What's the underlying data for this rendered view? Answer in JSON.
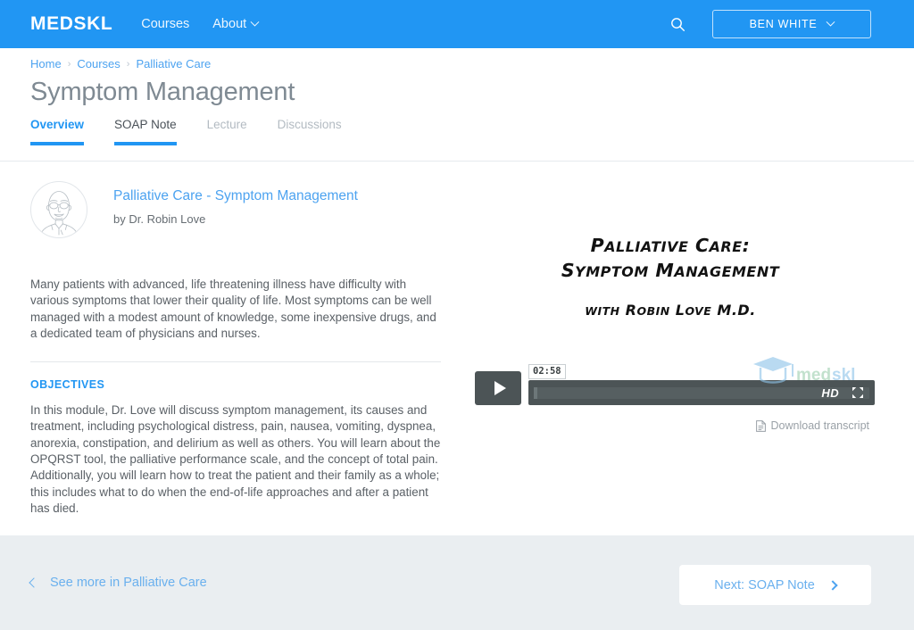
{
  "theme": {
    "brand_blue": "#2196f3",
    "link_blue": "#4da3f0",
    "title_gray": "#7f8a93",
    "body_gray": "#5a6066",
    "footer_bg": "#eaeef1",
    "player_dark": "#4c5456"
  },
  "topnav": {
    "brand": "MEDSKL",
    "links": [
      {
        "label": "Courses",
        "has_caret": false
      },
      {
        "label": "About",
        "has_caret": true
      }
    ],
    "search_icon": "search-icon",
    "user": {
      "label": "BEN WHITE",
      "caret_icon": "chevron-down-icon"
    }
  },
  "breadcrumb": {
    "items": [
      "Home",
      "Courses",
      "Palliative Care"
    ],
    "separator": "›"
  },
  "page": {
    "title": "Symptom Management"
  },
  "tabs": [
    {
      "label": "Overview",
      "state": "active"
    },
    {
      "label": "SOAP Note",
      "state": "underline"
    },
    {
      "label": "Lecture",
      "state": "inactive"
    },
    {
      "label": "Discussions",
      "state": "inactive"
    }
  ],
  "course": {
    "avatar_name": "instructor-avatar",
    "link_title": "Palliative Care - Symptom Management",
    "byline": "by Dr. Robin Love",
    "intro": "Many patients with advanced, life threatening illness have difficulty with various symptoms that lower their quality of life. Most symptoms can be well managed with a modest amount of knowledge, some inexpensive drugs, and a dedicated team of physicians and nurses.",
    "objectives_heading": "OBJECTIVES",
    "objectives_body": "In this module, Dr. Love will discuss symptom management, its causes and treatment, including psychological distress, pain, nausea, vomiting, dyspnea, anorexia, constipation, and delirium as well as others. You will learn about the OPQRST tool, the palliative performance scale, and the concept of total pain. Additionally, you will learn how to treat the patient and their family as a whole; this includes what to do when the end-of-life approaches and after a patient has died."
  },
  "video": {
    "title_line1": "Palliative Care:",
    "title_line2": "Symptom Management",
    "title_line3": "with Robin Love M.D.",
    "watermark_text": "medskl",
    "player": {
      "play_icon": "play-icon",
      "time_tooltip": "02:58",
      "quality_badge": "HD",
      "fullscreen_icon": "fullscreen-icon",
      "progress_percent": 1
    },
    "transcript_label": "Download transcript",
    "transcript_icon": "document-icon"
  },
  "footer": {
    "see_more_label": "See more in Palliative Care",
    "see_more_icon": "chevron-left-icon",
    "next_label": "Next: SOAP Note",
    "next_icon": "chevron-right-icon"
  }
}
